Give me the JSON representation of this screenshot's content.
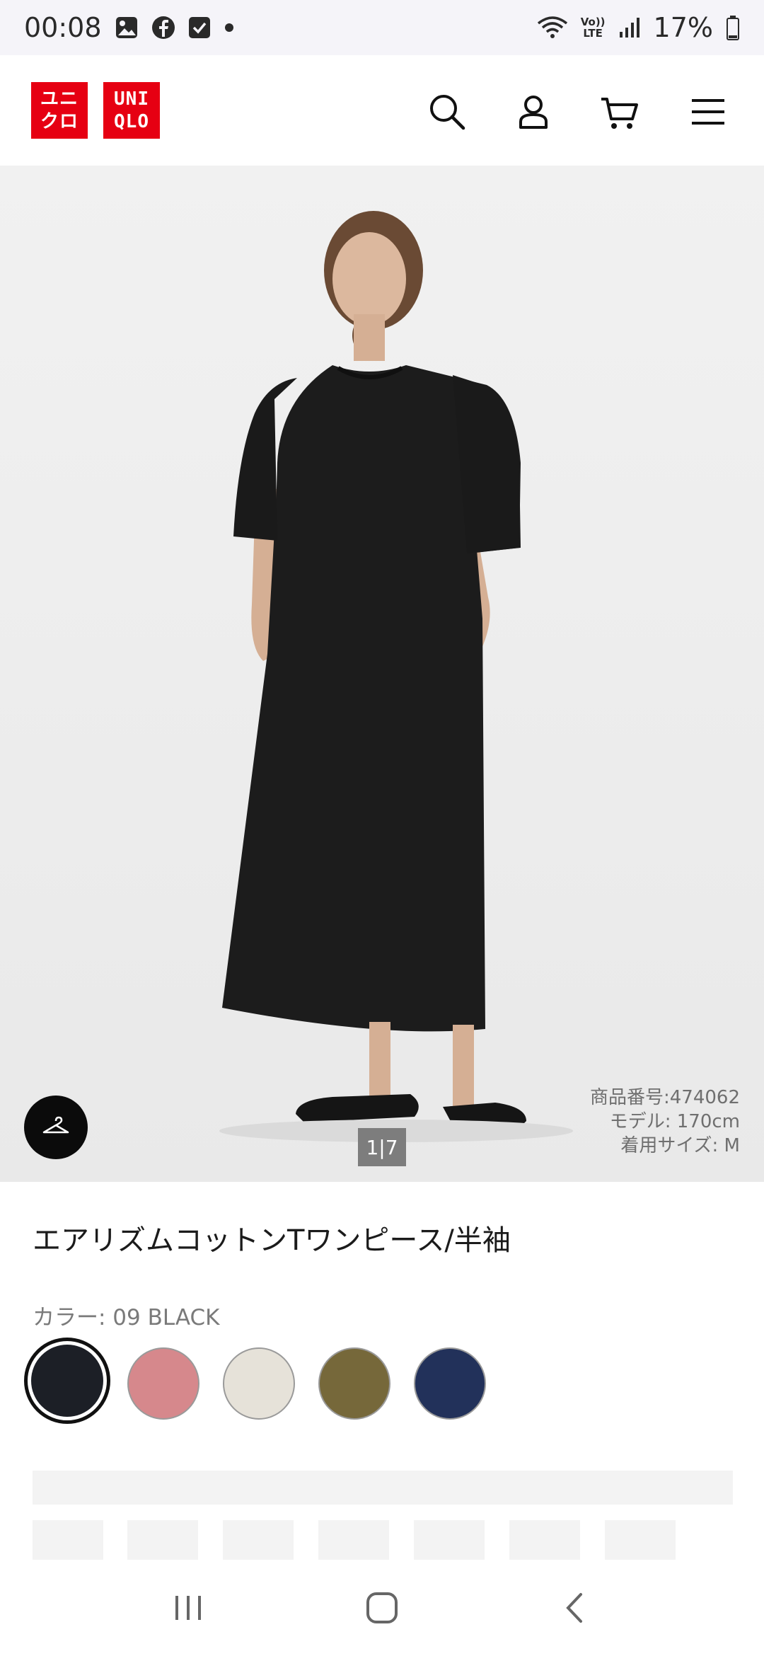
{
  "status_bar": {
    "time": "00:08",
    "battery": "17%",
    "network_label_top": "Vo))",
    "network_label_bottom": "LTE",
    "icons": [
      "gallery-icon",
      "facebook-icon",
      "checkbox-icon",
      "dot-icon",
      "wifi-icon",
      "volte-icon",
      "signal-icon",
      "battery-icon"
    ]
  },
  "header": {
    "logo_left": [
      "ユニ",
      "クロ"
    ],
    "logo_right": [
      "UNI",
      "QLO"
    ],
    "brand_color": "#e60012",
    "icons": [
      "search-icon",
      "account-icon",
      "cart-icon",
      "menu-icon"
    ]
  },
  "hero": {
    "image_counter": "1|7",
    "product_code": "商品番号:474062",
    "model_height": "モデル: 170cm",
    "size_worn": "着用サイズ: M",
    "hanger_icon": "hanger-icon"
  },
  "product": {
    "title": "エアリズムコットンTワンピース/半袖",
    "color_label": "カラー: 09 BLACK",
    "swatches": [
      {
        "name": "09 BLACK",
        "color": "#1c1f26",
        "selected": true
      },
      {
        "name": "pink",
        "color": "#d6888c",
        "selected": false
      },
      {
        "name": "off-white",
        "color": "#e6e2d9",
        "selected": false
      },
      {
        "name": "olive",
        "color": "#76683a",
        "selected": false
      },
      {
        "name": "navy",
        "color": "#22315a",
        "selected": false
      }
    ]
  },
  "nav_bar": {
    "icons": [
      "recent-apps-icon",
      "home-icon",
      "back-icon"
    ]
  }
}
